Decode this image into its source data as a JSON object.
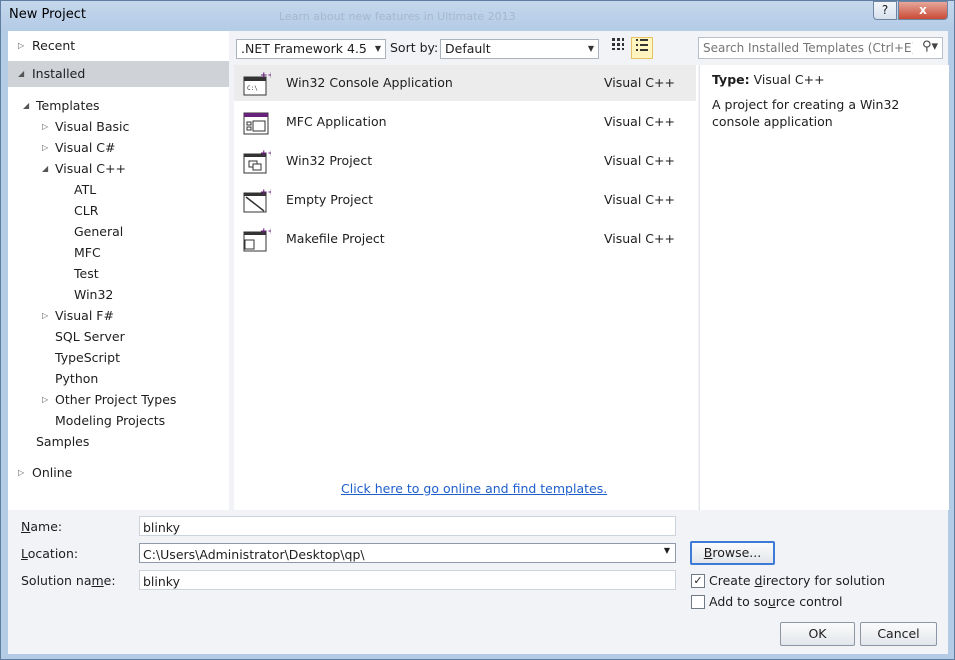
{
  "window": {
    "title": "New Project",
    "faint_banner": "Learn about new features in Ultimate 2013",
    "help_label": "?",
    "close_label": "x"
  },
  "left": {
    "recent": "Recent",
    "installed": "Installed",
    "online": "Online",
    "tree": {
      "templates": "Templates",
      "visual_basic": "Visual Basic",
      "visual_csharp": "Visual C#",
      "visual_cpp": "Visual C++",
      "atl": "ATL",
      "clr": "CLR",
      "general": "General",
      "mfc": "MFC",
      "test": "Test",
      "win32": "Win32",
      "visual_fsharp": "Visual F#",
      "sql_server": "SQL Server",
      "typescript": "TypeScript",
      "python": "Python",
      "other_project_types": "Other Project Types",
      "modeling_projects": "Modeling Projects",
      "samples": "Samples"
    }
  },
  "toolbar": {
    "framework": ".NET Framework 4.5",
    "sort_label": "Sort by:",
    "sort_value": "Default",
    "search_placeholder": "Search Installed Templates (Ctrl+E)"
  },
  "templates": [
    {
      "name": "Win32 Console Application",
      "language": "Visual C++",
      "icon": "console-app-icon"
    },
    {
      "name": "MFC Application",
      "language": "Visual C++",
      "icon": "mfc-app-icon"
    },
    {
      "name": "Win32 Project",
      "language": "Visual C++",
      "icon": "win32-project-icon"
    },
    {
      "name": "Empty Project",
      "language": "Visual C++",
      "icon": "empty-project-icon"
    },
    {
      "name": "Makefile Project",
      "language": "Visual C++",
      "icon": "makefile-project-icon"
    }
  ],
  "online_link": "Click here to go online and find templates.",
  "detail": {
    "type_label": "Type:",
    "type_value": "Visual C++",
    "description": "A project for creating a Win32 console application"
  },
  "form": {
    "name_label_pre": "",
    "name_label_u": "N",
    "name_label_post": "ame:",
    "name_value": "blinky",
    "location_label_pre": "",
    "location_label_u": "L",
    "location_label_post": "ocation:",
    "location_value": "C:\\Users\\Administrator\\Desktop\\qp\\",
    "solution_label_pre": "Solution na",
    "solution_label_u": "m",
    "solution_label_post": "e:",
    "solution_value": "blinky",
    "browse_pre": "",
    "browse_u": "B",
    "browse_post": "rowse...",
    "create_dir_pre": "Create ",
    "create_dir_u": "d",
    "create_dir_post": "irectory for solution",
    "create_dir_checked": true,
    "source_control_pre": "Add to so",
    "source_control_u": "u",
    "source_control_post": "rce control",
    "source_control_checked": false,
    "ok": "OK",
    "cancel": "Cancel"
  },
  "colors": {
    "accent": "#68217a",
    "link": "#1e5fcc",
    "selection": "#cfd3d8"
  }
}
